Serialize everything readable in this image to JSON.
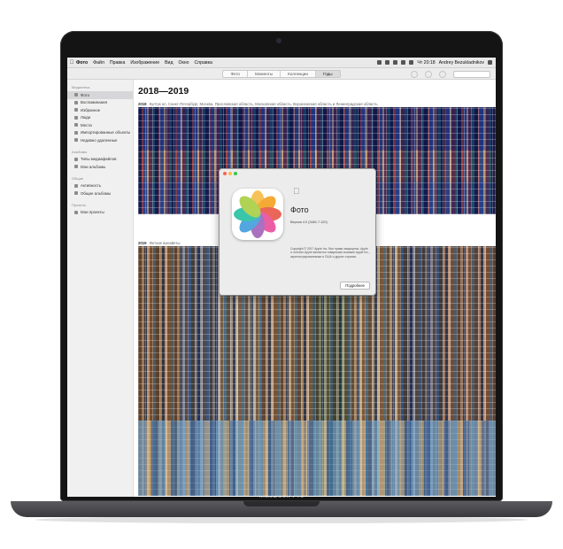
{
  "device": {
    "label": "MacBook Pro"
  },
  "menubar": {
    "items": [
      "Фото",
      "Файл",
      "Правка",
      "Изображение",
      "Вид",
      "Окно",
      "Справка"
    ],
    "clock": "Чт 20:18",
    "user": "Andrey Bezukladnikov"
  },
  "toolbar": {
    "tabs": [
      "Фото",
      "Моменты",
      "Коллекции",
      "Годы"
    ],
    "active_tab": "Годы"
  },
  "sidebar": {
    "sections": [
      {
        "heading": "Медиатека",
        "items": [
          "Фото",
          "Воспоминания",
          "Избранное",
          "Люди",
          "Места",
          "Импортированные объекты",
          "Недавно удаленные"
        ]
      },
      {
        "heading": "Альбомы",
        "items": [
          "Типы медиафайлов",
          "Мои альбомы"
        ]
      },
      {
        "heading": "Общие",
        "items": [
          "Активность",
          "Общие альбомы"
        ]
      },
      {
        "heading": "Проекты",
        "items": [
          "Мои проекты"
        ]
      }
    ],
    "selected": "Фото"
  },
  "main": {
    "title": "2018—2019",
    "year1": {
      "year": "2018",
      "places": "Култук нп, Санкт-Петербург, Москва, Ярославская область, Московская область, Воронежская область и Ленинградская область"
    },
    "year2": {
      "year": "2019",
      "places": "Фетхие вилайеты"
    }
  },
  "dialog": {
    "app_name": "Фото",
    "version": "Версия 4.0 (3461.7.120)",
    "copyright": "Copyright © 2017 Apple Inc. Все права защищены. Apple и логотип Apple являются товарными знаками Apple Inc., зарегистрированными в США и других странах.",
    "button": "Подробнее"
  },
  "colors": {
    "menubar_bg": "#e9e9ea",
    "sidebar_bg": "#f0f0f0",
    "selection": "#d6d6d8"
  }
}
